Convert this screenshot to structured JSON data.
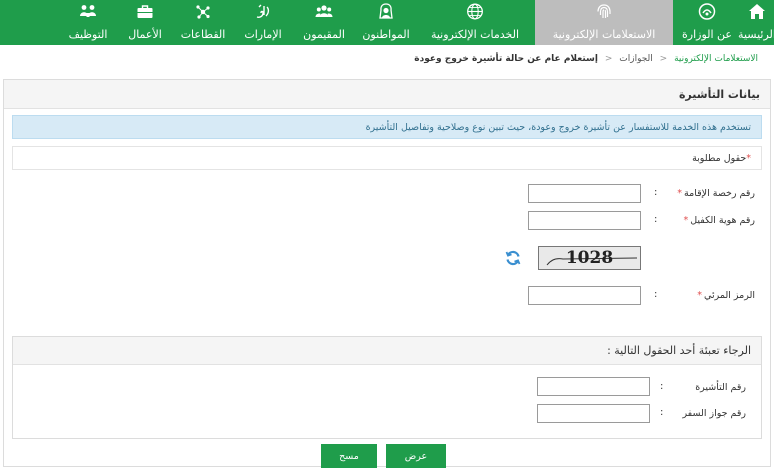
{
  "nav": {
    "items": [
      {
        "label": "الرئيسية",
        "icon": "home-icon"
      },
      {
        "label": "عن الوزارة",
        "icon": "ministry-emblem-icon"
      },
      {
        "label": "الاستعلامات الإلكترونية",
        "icon": "fingerprint-icon",
        "active": true
      },
      {
        "label": "الخدمات الإلكترونية",
        "icon": "globe-icon"
      },
      {
        "label": "المواطنون",
        "icon": "citizen-icon"
      },
      {
        "label": "المقيمون",
        "icon": "residents-group-icon"
      },
      {
        "label": "الإمارات",
        "icon": "calligraphy-icon"
      },
      {
        "label": "القطاعات",
        "icon": "network-icon"
      },
      {
        "label": "الأعمال",
        "icon": "briefcase-icon"
      },
      {
        "label": "التوظيف",
        "icon": "people-icon"
      }
    ],
    "colors": {
      "bar": "#1f9d4b",
      "active": "#bdbdbd"
    }
  },
  "breadcrumb": {
    "root": "الاستعلامات الإلكترونية",
    "section": "الجوازات",
    "current": "إستعلام عام عن حالة تأشيرة خروج وعودة",
    "separator": "<"
  },
  "panel": {
    "title": "بيانات التأشيرة",
    "info": "تستخدم هذه الخدمة للاستفسار عن تأشيرة خروج وعودة، حيث تبين نوع وصلاحية وتفاصيل التأشيرة",
    "required_note": "حقول مطلوبة",
    "required_star": "*",
    "fields": {
      "residence_label": "رقم رخصة الإقامة",
      "sponsor_label": "رقم هوية الكفيل",
      "captcha_label": "الرمز المرئي",
      "colon": ":"
    },
    "captcha_text": "1028"
  },
  "section2": {
    "title": "الرجاء تعبئة أحد الحقول التالية :",
    "visa_label": "رقم التأشيرة",
    "passport_label": "رقم جواز السفر",
    "colon": ":"
  },
  "buttons": {
    "show": "عرض",
    "clear": "مسح"
  }
}
